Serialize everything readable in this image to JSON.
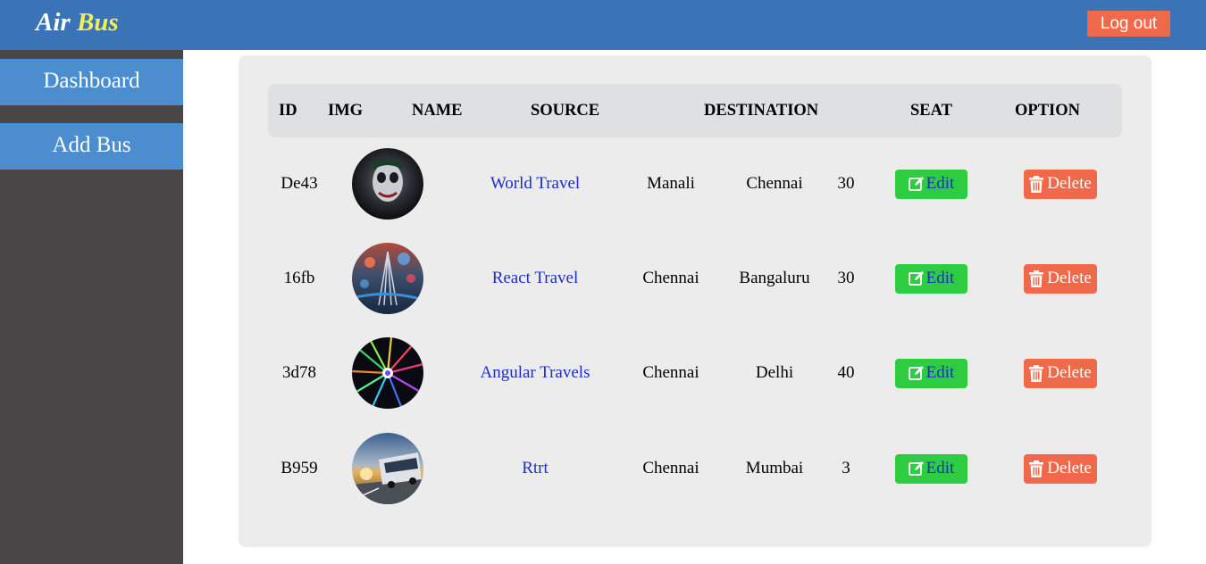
{
  "header": {
    "brand_part1": "Air",
    "brand_part2": "Bus",
    "logout_label": "Log out"
  },
  "sidebar": {
    "items": [
      {
        "label": "Dashboard"
      },
      {
        "label": "Add Bus"
      }
    ]
  },
  "table": {
    "columns": [
      "ID",
      "IMG",
      "NAME",
      "SOURCE",
      "DESTINATION",
      "SEAT",
      "OPTION"
    ],
    "edit_label": "Edit",
    "delete_label": "Delete",
    "rows": [
      {
        "id": "De43",
        "image": "joker-face-photo",
        "name": "World Travel",
        "source": "Manali",
        "destination": "Chennai",
        "seat": "30"
      },
      {
        "id": "16fb",
        "image": "city-lights-photo",
        "name": "React Travel",
        "source": "Chennai",
        "destination": "Bangaluru",
        "seat": "30"
      },
      {
        "id": "3d78",
        "image": "light-burst-photo",
        "name": "Angular Travels",
        "source": "Chennai",
        "destination": "Delhi",
        "seat": "40"
      },
      {
        "id": "B959",
        "image": "bus-road-photo",
        "name": "Rtrt",
        "source": "Chennai",
        "destination": "Mumbai",
        "seat": "3"
      }
    ]
  },
  "colors": {
    "header_bg": "#3a74b6",
    "brand_accent": "#f2ee5a",
    "sidebar_bg": "#484647",
    "sidebar_item_bg": "#4b8dce",
    "edit_bg": "#2ecc40",
    "delete_bg": "#f0694a",
    "link_text": "#1a2fc7"
  },
  "icons": {
    "edit": "pencil-square-icon",
    "delete": "trash-icon"
  }
}
